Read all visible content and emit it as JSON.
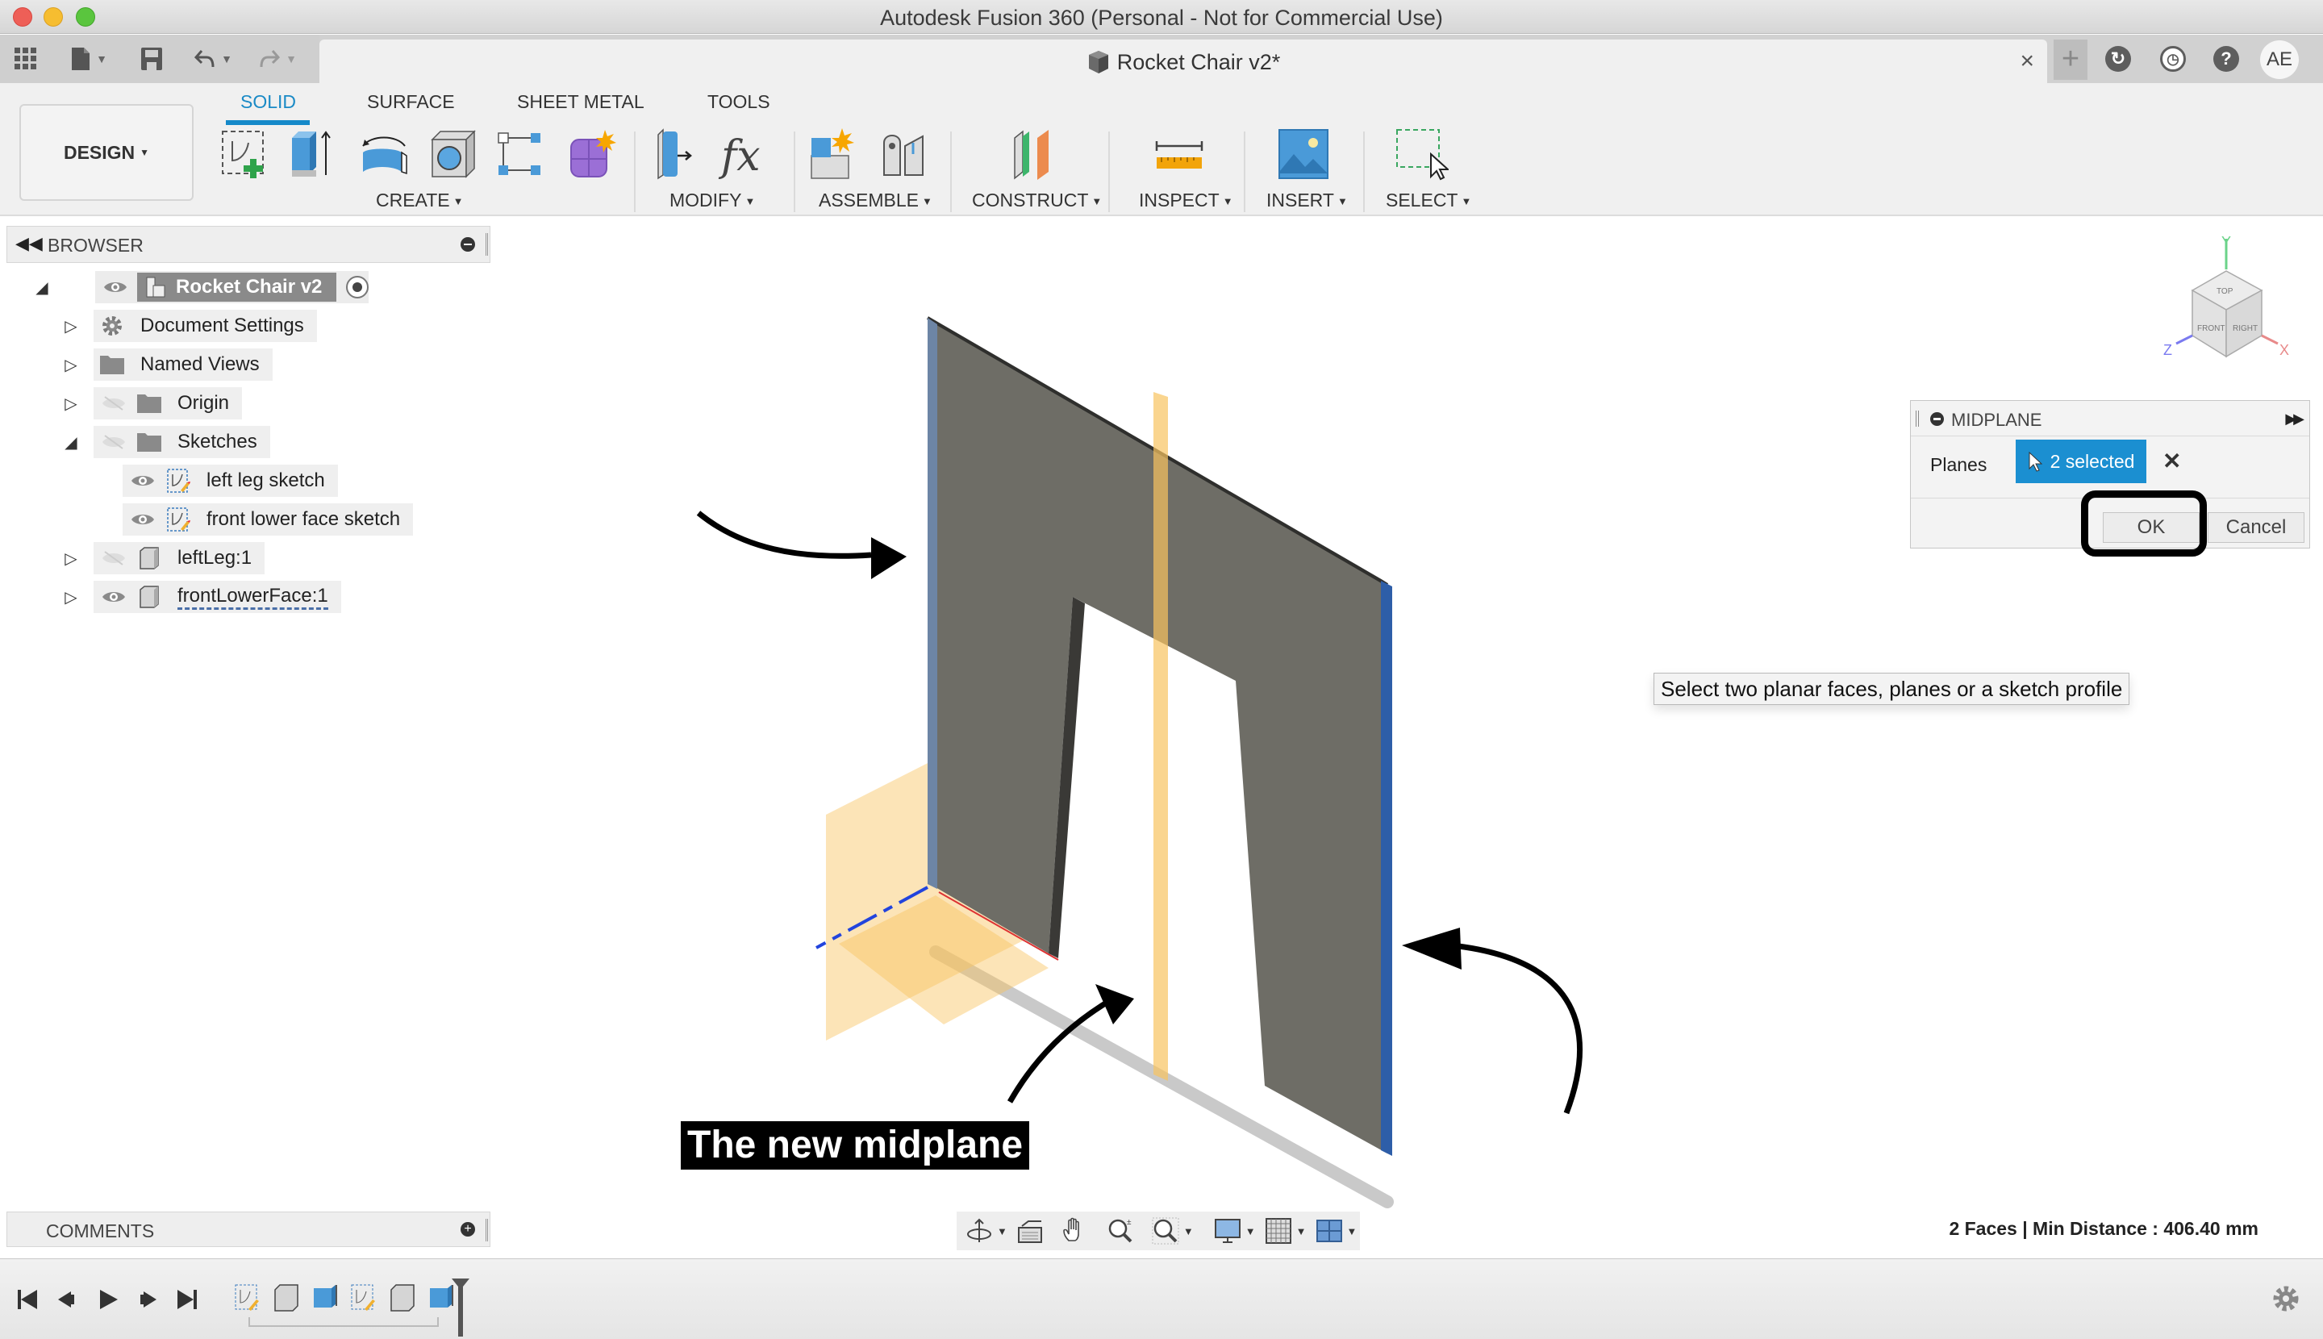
{
  "window": {
    "title": "Autodesk Fusion 360 (Personal - Not for Commercial Use)"
  },
  "quick_access": {
    "icons": [
      "data-panel-icon",
      "file-icon",
      "save-icon",
      "undo-icon",
      "redo-icon"
    ]
  },
  "document_tab": {
    "label": "Rocket Chair v2*",
    "close": "×"
  },
  "top_right": {
    "new_tab": "+",
    "icons": [
      "job-status-icon",
      "notifications-icon",
      "help-icon"
    ],
    "avatar_initials": "AE"
  },
  "ribbon": {
    "workspace": "DESIGN",
    "tabs": [
      {
        "label": "SOLID",
        "active": true
      },
      {
        "label": "SURFACE",
        "active": false
      },
      {
        "label": "SHEET METAL",
        "active": false
      },
      {
        "label": "TOOLS",
        "active": false
      }
    ],
    "groups": [
      {
        "label": "CREATE",
        "tools": [
          "create-sketch",
          "extrude",
          "revolve",
          "hole",
          "pattern",
          "create-form"
        ]
      },
      {
        "label": "MODIFY",
        "tools": [
          "press-pull",
          "parameters"
        ]
      },
      {
        "label": "ASSEMBLE",
        "tools": [
          "new-component",
          "joint"
        ]
      },
      {
        "label": "CONSTRUCT",
        "tools": [
          "midplane"
        ]
      },
      {
        "label": "INSPECT",
        "tools": [
          "measure"
        ]
      },
      {
        "label": "INSERT",
        "tools": [
          "insert-image"
        ]
      },
      {
        "label": "SELECT",
        "tools": [
          "select"
        ]
      }
    ],
    "caret": "▼"
  },
  "browser": {
    "title": "BROWSER",
    "root": {
      "label": "Rocket Chair v2",
      "expanded": true
    },
    "items": [
      {
        "label": "Document Settings",
        "level": 1,
        "expanded": false,
        "visible": null,
        "icon": "gear-icon"
      },
      {
        "label": "Named Views",
        "level": 1,
        "expanded": false,
        "visible": null,
        "icon": "folder-icon"
      },
      {
        "label": "Origin",
        "level": 1,
        "expanded": false,
        "visible": false,
        "icon": "folder-icon"
      },
      {
        "label": "Sketches",
        "level": 1,
        "expanded": true,
        "visible": false,
        "icon": "folder-icon"
      },
      {
        "label": "left leg sketch",
        "level": 2,
        "expanded": null,
        "visible": true,
        "icon": "sketch-icon"
      },
      {
        "label": "front lower face sketch",
        "level": 2,
        "expanded": null,
        "visible": true,
        "icon": "sketch-icon"
      },
      {
        "label": "leftLeg:1",
        "level": 1,
        "expanded": false,
        "visible": false,
        "icon": "body-icon"
      },
      {
        "label": "frontLowerFace:1",
        "level": 1,
        "expanded": false,
        "visible": true,
        "icon": "body-icon"
      }
    ]
  },
  "midplane_dialog": {
    "title": "MIDPLANE",
    "field_label": "Planes",
    "selection": "2 selected",
    "clear": "✕",
    "ok": "OK",
    "cancel": "Cancel"
  },
  "tooltip": "Select two planar faces, planes or a sketch profile",
  "annotation": "The new midplane",
  "viewcube": {
    "faces": [
      "TOP",
      "FRONT",
      "RIGHT"
    ],
    "axes": [
      "X",
      "Y",
      "Z"
    ]
  },
  "comments": {
    "title": "COMMENTS"
  },
  "navbar": {
    "tools": [
      "orbit",
      "look-at",
      "pan",
      "zoom",
      "fit",
      "display-settings",
      "grid-settings",
      "viewports"
    ]
  },
  "status_bar": {
    "text": "2 Faces | Min Distance : 406.40 mm"
  },
  "timeline": {
    "controls": [
      "go-to-start",
      "step-back",
      "play",
      "step-forward",
      "go-to-end"
    ],
    "features": [
      "sketch",
      "body",
      "extrude",
      "sketch",
      "body",
      "extrude"
    ]
  },
  "colors": {
    "accent": "#1b8fd1",
    "tab_active": "#1a8ac6",
    "selected_face": "#2e5ea8",
    "plane_fill": "#f8c35f",
    "body": "#6e6d66"
  }
}
